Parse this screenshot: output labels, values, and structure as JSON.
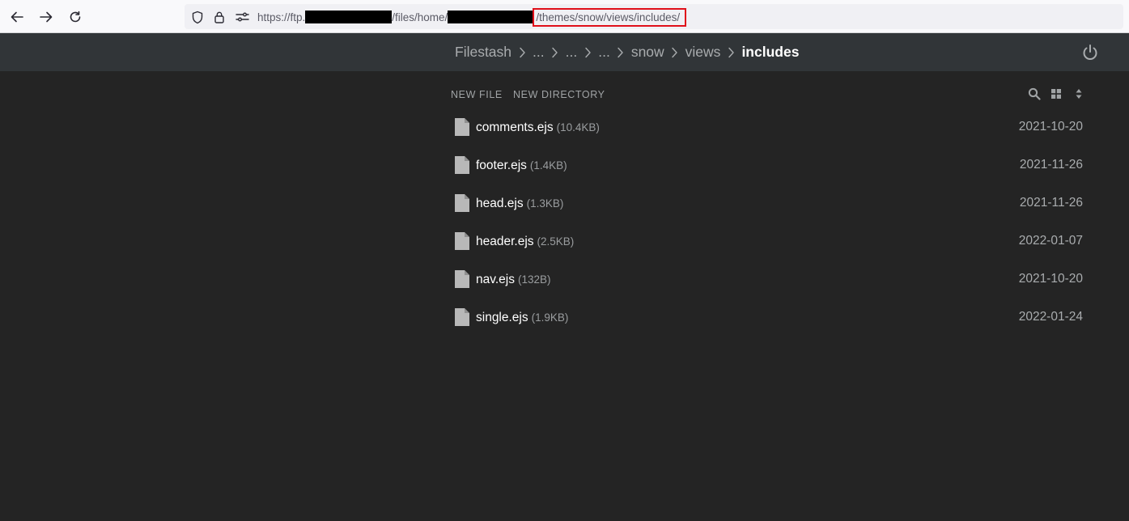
{
  "browser": {
    "url_prefix": "https://ftp.",
    "url_middle": "/files/home/",
    "url_highlighted": "/themes/snow/views/includes/",
    "highlight_color": "#e0101a",
    "icons": [
      "back-arrow-icon",
      "forward-arrow-icon",
      "reload-icon",
      "shield-icon",
      "lock-icon",
      "permissions-icon"
    ]
  },
  "app": {
    "breadcrumb": [
      {
        "label": "Filestash"
      },
      {
        "label": "..."
      },
      {
        "label": "..."
      },
      {
        "label": "..."
      },
      {
        "label": "snow"
      },
      {
        "label": "views"
      },
      {
        "label": "includes"
      }
    ],
    "logout_icon": "power-icon"
  },
  "toolbar": {
    "new_file_label": "NEW FILE",
    "new_directory_label": "NEW DIRECTORY",
    "icons": [
      "search-icon",
      "grid-view-icon",
      "sort-icon"
    ]
  },
  "files": [
    {
      "name": "comments.ejs",
      "size": "(10.4KB)",
      "date": "2021-10-20"
    },
    {
      "name": "footer.ejs",
      "size": "(1.4KB)",
      "date": "2021-11-26"
    },
    {
      "name": "head.ejs",
      "size": "(1.3KB)",
      "date": "2021-11-26"
    },
    {
      "name": "header.ejs",
      "size": "(2.5KB)",
      "date": "2022-01-07"
    },
    {
      "name": "nav.ejs",
      "size": "(132B)",
      "date": "2021-10-20"
    },
    {
      "name": "single.ejs",
      "size": "(1.9KB)",
      "date": "2022-01-24"
    }
  ],
  "colors": {
    "background": "#242424",
    "header": "#313538",
    "file_icon": "#b8b8b8"
  }
}
